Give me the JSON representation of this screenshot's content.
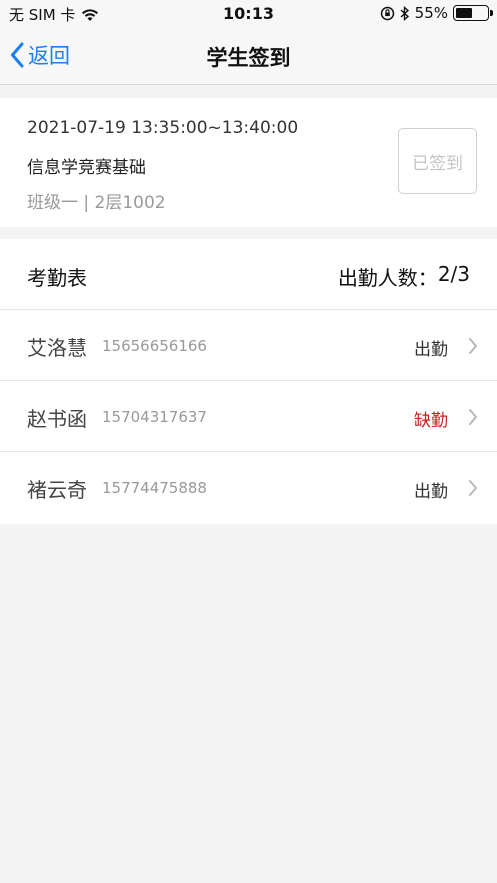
{
  "status_bar": {
    "carrier": "无 SIM 卡",
    "time": "10:13",
    "battery": "55%",
    "battery_level": 0.55
  },
  "nav": {
    "back_label": "返回",
    "title": "学生签到"
  },
  "session": {
    "time": "2021-07-19 13:35:00~13:40:00",
    "course": "信息学竞赛基础",
    "location": "班级一 | 2层1002",
    "signed_label": "已签到"
  },
  "attendance": {
    "title": "考勤表",
    "count_label": "出勤人数：",
    "count_value": "2/3",
    "students": [
      {
        "name": "艾洛慧",
        "phone": "15656656166",
        "status": "出勤"
      },
      {
        "name": "赵书函",
        "phone": "15704317637",
        "status": "缺勤"
      },
      {
        "name": "褚云奇",
        "phone": "15774475888",
        "status": "出勤"
      }
    ]
  },
  "colors": {
    "accent": "#1a7ff0",
    "absent": "#c81e1e"
  }
}
